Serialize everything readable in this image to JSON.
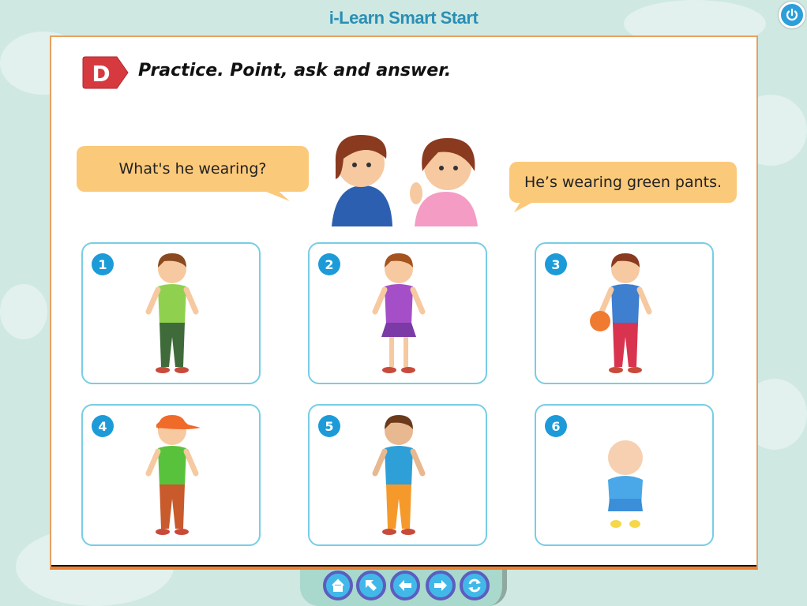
{
  "app_title": "i-Learn Smart Start",
  "section_letter": "D",
  "heading": "Practice. Point, ask and answer.",
  "bubbles": {
    "question": "What's he wearing?",
    "answer": "He’s wearing green pants."
  },
  "cards": [
    {
      "number": "1",
      "top": "#8fd14f",
      "bottom": "#3f6b3a",
      "skin": "#f6c9a0",
      "hair": "#8a4a20"
    },
    {
      "number": "2",
      "top": "#a44fc8",
      "bottom": "#7b3aa5",
      "skin": "#f6c9a0",
      "hair": "#a5531f"
    },
    {
      "number": "3",
      "top": "#3e7fd0",
      "bottom": "#d8344f",
      "skin": "#f6c9a0",
      "hair": "#8a3a1f"
    },
    {
      "number": "4",
      "top": "#59c23c",
      "bottom": "#c85a2c",
      "skin": "#f6c9a0",
      "hair": "#f06a2a"
    },
    {
      "number": "5",
      "top": "#2f9fd8",
      "bottom": "#f59a2a",
      "skin": "#e8b890",
      "hair": "#6a3a1a"
    },
    {
      "number": "6",
      "top": "#4aa8e8",
      "bottom": "#3b8fd8",
      "skin": "#f6d0b0",
      "hair": "#d8a080"
    }
  ],
  "nav": [
    {
      "name": "home",
      "label": "Home"
    },
    {
      "name": "back-to-menu",
      "label": "Menu"
    },
    {
      "name": "previous",
      "label": "Previous"
    },
    {
      "name": "next",
      "label": "Next"
    },
    {
      "name": "refresh",
      "label": "Refresh"
    }
  ]
}
